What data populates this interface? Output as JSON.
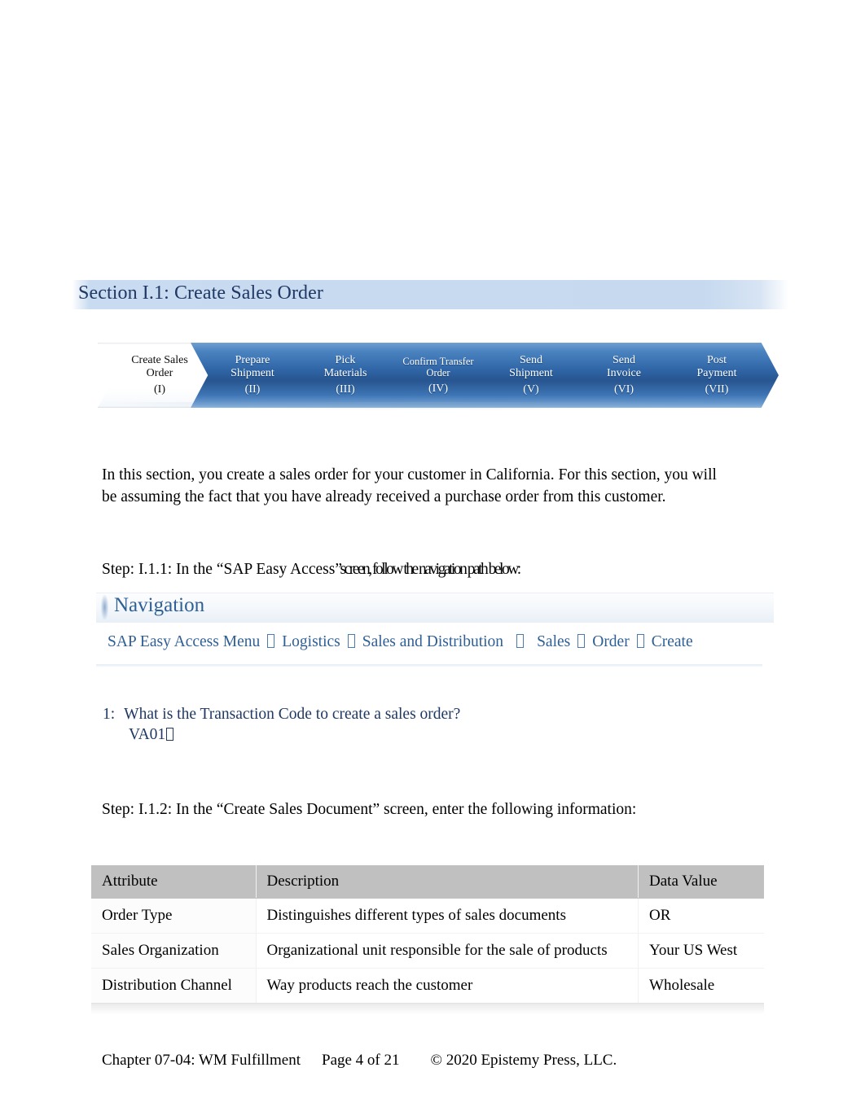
{
  "section": {
    "heading": "Section I.1: Create Sales Order"
  },
  "process_flow": {
    "steps": [
      {
        "line1": "Create Sales",
        "line2": "Order",
        "numeral": "(I)",
        "state": "current"
      },
      {
        "line1": "Prepare",
        "line2": "Shipment",
        "numeral": "(II)",
        "state": "upcoming"
      },
      {
        "line1": "Pick",
        "line2": "Materials",
        "numeral": "(III)",
        "state": "upcoming"
      },
      {
        "line1": "Confirm Transfer",
        "line2": "Order",
        "numeral": "(IV)",
        "state": "upcoming"
      },
      {
        "line1": "Send",
        "line2": "Shipment",
        "numeral": "(V)",
        "state": "upcoming"
      },
      {
        "line1": "Send",
        "line2": "Invoice",
        "numeral": "(VI)",
        "state": "upcoming"
      },
      {
        "line1": "Post",
        "line2": "Payment",
        "numeral": "(VII)",
        "state": "upcoming"
      }
    ],
    "current_color": "#ffffff",
    "upcoming_color": "#2f65a6"
  },
  "intro_paragraph": "In this section, you create a sales order for your customer in California. For this section, you will be assuming the fact that you have already received a purchase order from this customer.",
  "step_1_1_1": {
    "prefix": "Step: I.1.1: In the “SAP Easy Access",
    "suffix": "”screen, follow the navigation path below:"
  },
  "navigation": {
    "title": "Navigation",
    "path_items": [
      "SAP Easy Access Menu",
      "Logistics",
      "Sales and Distribution",
      "Sales",
      "Order",
      "Create"
    ],
    "separator_glyph": "missing-glyph-box",
    "text_color": "#2e5f95"
  },
  "question": {
    "number": "1:",
    "text": "What is the Transaction Code to create a sales order?",
    "answer": "VA01",
    "answer_color": "#1f3864"
  },
  "step_1_1_2": "Step: I.1.2: In the “Create Sales Document” screen, enter the following information:",
  "table": {
    "headers": [
      "Attribute",
      "Description",
      "Data Value"
    ],
    "header_bg": "#c0c0c0",
    "rows": [
      {
        "attribute": "Order Type",
        "description": "Distinguishes different types of sales documents",
        "data_value": "OR"
      },
      {
        "attribute": "Sales Organization",
        "description": "Organizational unit responsible for the sale of products",
        "data_value": "Your US West"
      },
      {
        "attribute": "Distribution Channel",
        "description": "Way products reach the customer",
        "data_value": "Wholesale"
      }
    ]
  },
  "footer": {
    "chapter": "Chapter 07-04: WM Fulfillment",
    "page": "Page 4 of 21",
    "copyright": "© 2020 Epistemy Press, LLC."
  }
}
